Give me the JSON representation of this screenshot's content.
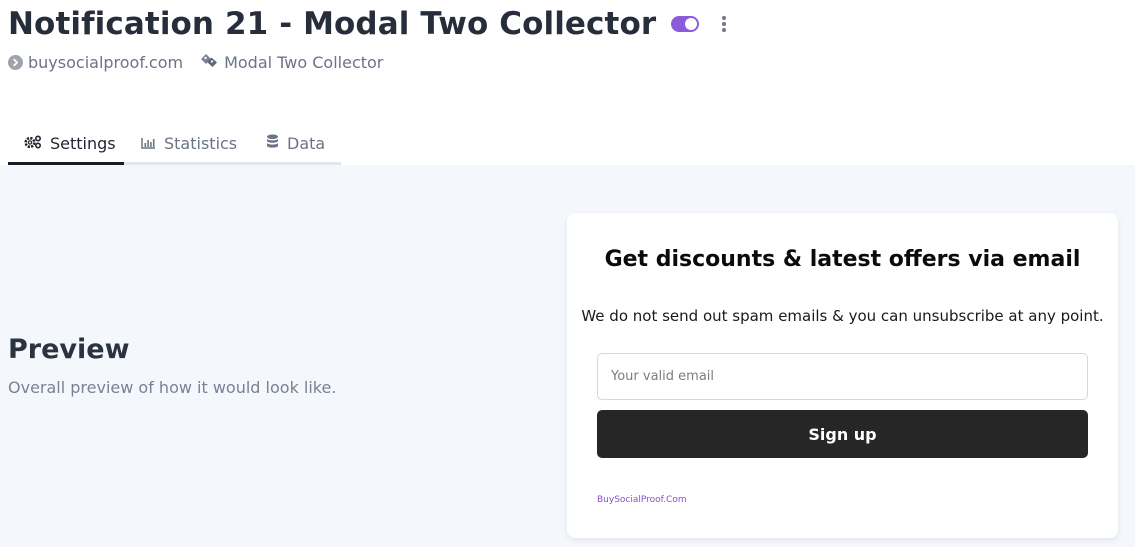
{
  "header": {
    "title": "Notification 21 - Modal Two Collector",
    "toggle": {
      "enabled": true,
      "color": "#8a5cdc"
    },
    "meta": {
      "site": "buysocialproof.com",
      "type": "Modal Two Collector"
    }
  },
  "tabs": [
    {
      "label": "Settings",
      "icon": "gears-icon",
      "active": true
    },
    {
      "label": "Statistics",
      "icon": "bar-chart-icon",
      "active": false
    },
    {
      "label": "Data",
      "icon": "database-icon",
      "active": false
    }
  ],
  "preview": {
    "heading": "Preview",
    "subtitle": "Overall preview of how it would look like."
  },
  "modal": {
    "title": "Get discounts & latest offers via email",
    "description": "We do not send out spam emails & you can unsubscribe at any point.",
    "email_placeholder": "Your valid email",
    "email_value": "",
    "button_label": "Sign up",
    "branding": "BuySocialProof.Com",
    "button_color": "#262626",
    "branding_color": "#8a4fc8"
  }
}
